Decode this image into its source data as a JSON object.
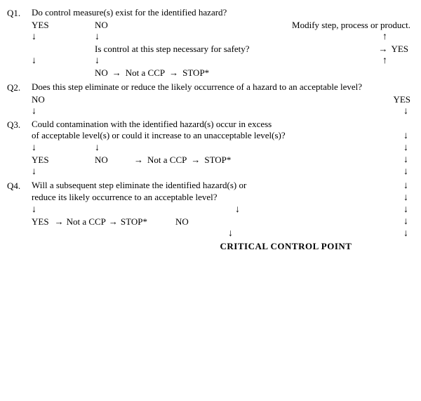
{
  "diagram": {
    "q1": {
      "label": "Q1.",
      "question": "Do control measure(s) exist for the identified hazard?",
      "yes": "YES",
      "no": "NO",
      "modify": "Modify step, process or product.",
      "sub_question": "Is control at this step necessary for safety?",
      "sub_yes": "YES",
      "sub_no": "NO",
      "not_ccp": "Not a CCP",
      "stop": "STOP*"
    },
    "q2": {
      "label": "Q2.",
      "question": "Does this step eliminate or reduce the likely occurrence of a hazard to an acceptable level?",
      "yes": "YES",
      "no": "NO"
    },
    "q3": {
      "label": "Q3.",
      "question_line1": "Could contamination with the identified hazard(s) occur in excess",
      "question_line2": "of acceptable level(s) or could it increase to an unacceptable level(s)?",
      "yes": "YES",
      "no": "NO",
      "not_ccp": "Not a CCP",
      "stop": "STOP*"
    },
    "q4": {
      "label": "Q4.",
      "question_line1": "Will a subsequent step eliminate the identified hazard(s) or",
      "question_line2": "reduce its likely occurrence to an acceptable level?",
      "yes": "YES",
      "not_ccp": "Not a CCP",
      "stop": "STOP*",
      "no": "NO"
    },
    "ccp": "CRITICAL CONTROL POINT"
  }
}
